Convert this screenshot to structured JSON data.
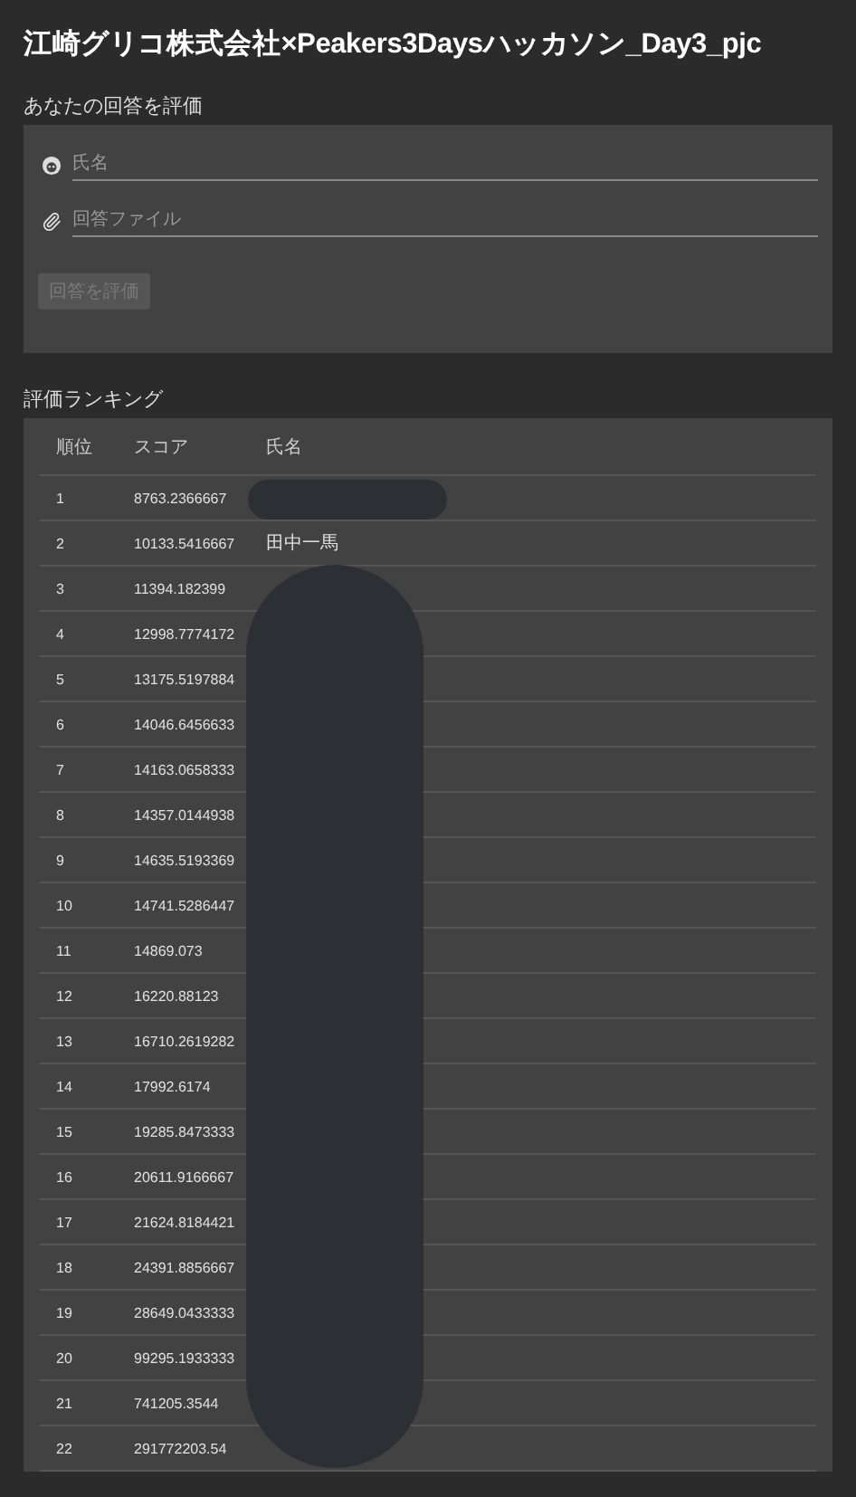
{
  "title": "江崎グリコ株式会社×Peakers3Daysハッカソン_Day3_pjc",
  "evaluate": {
    "heading": "あなたの回答を評価",
    "fields": [
      {
        "kind": "name",
        "placeholder": "氏名"
      },
      {
        "kind": "file",
        "placeholder": "回答ファイル"
      }
    ],
    "submit": {
      "label": "回答を評価",
      "disabled": true
    }
  },
  "ranking": {
    "heading": "評価ランキング",
    "columns": [
      "順位",
      "スコア",
      "氏名"
    ],
    "rows": [
      {
        "rank": "1",
        "score": "8763.2366667"
      },
      {
        "rank": "2",
        "score": "10133.5416667",
        "name": "田中一馬"
      },
      {
        "rank": "3",
        "score": "11394.182399"
      },
      {
        "rank": "4",
        "score": "12998.7774172"
      },
      {
        "rank": "5",
        "score": "13175.5197884"
      },
      {
        "rank": "6",
        "score": "14046.6456633"
      },
      {
        "rank": "7",
        "score": "14163.0658333"
      },
      {
        "rank": "8",
        "score": "14357.0144938"
      },
      {
        "rank": "9",
        "score": "14635.5193369"
      },
      {
        "rank": "10",
        "score": "14741.5286447"
      },
      {
        "rank": "11",
        "score": "14869.073"
      },
      {
        "rank": "12",
        "score": "16220.88123"
      },
      {
        "rank": "13",
        "score": "16710.2619282"
      },
      {
        "rank": "14",
        "score": "17992.6174"
      },
      {
        "rank": "15",
        "score": "19285.8473333"
      },
      {
        "rank": "16",
        "score": "20611.9166667"
      },
      {
        "rank": "17",
        "score": "21624.8184421"
      },
      {
        "rank": "18",
        "score": "24391.8856667"
      },
      {
        "rank": "19",
        "score": "28649.0433333"
      },
      {
        "rank": "20",
        "score": "99295.1933333"
      },
      {
        "rank": "21",
        "score": "741205.3544"
      },
      {
        "rank": "22",
        "score": "291772203.54"
      }
    ]
  }
}
